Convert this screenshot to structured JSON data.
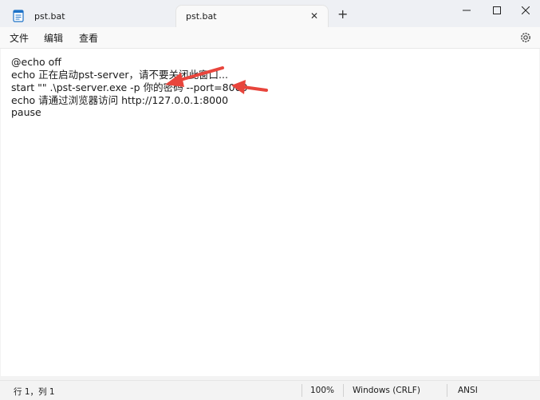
{
  "tabs": [
    {
      "label": "pst.bat",
      "icon": "notepad-file-icon",
      "active": false
    },
    {
      "label": "pst.bat",
      "icon": "notepad-file-icon",
      "active": true
    }
  ],
  "menu": {
    "file": "文件",
    "edit": "编辑",
    "view": "查看"
  },
  "editor": {
    "lines": [
      "@echo off",
      "echo 正在启动pst-server，请不要关闭此窗口...",
      "start \"\" .\\pst-server.exe -p 你的密码 --port=8000",
      "echo 请通过浏览器访问 http://127.0.0.1:8000",
      "pause"
    ]
  },
  "status": {
    "position": "行 1，列 1",
    "zoom": "100%",
    "line_ending": "Windows (CRLF)",
    "encoding": "ANSI"
  },
  "colors": {
    "arrow": "#e8453c",
    "titlebar": "#eef0f4",
    "editor_bg": "#ffffff",
    "icon_blue": "#1e73c8"
  }
}
